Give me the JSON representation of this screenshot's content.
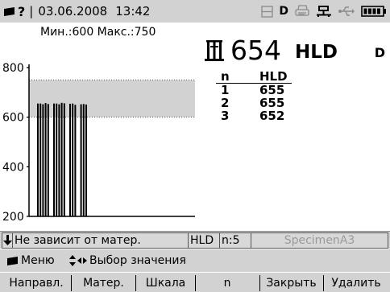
{
  "status_bar": {
    "indicator": "?",
    "separator": "|",
    "date": "03.06.2008",
    "time": "13:42",
    "mode_letter": "D",
    "icons": [
      "memory-card-icon",
      "ready-indicator",
      "printer-icon",
      "network-icon",
      "usb-icon",
      "battery-icon"
    ]
  },
  "chart_data": {
    "type": "bar",
    "ylim": [
      200,
      800
    ],
    "yticks": [
      "800",
      "600",
      "400",
      "200"
    ],
    "ytick_values": [
      800,
      600,
      400,
      200
    ],
    "limit_band": [
      600,
      750
    ],
    "limit_label": "Мин.:600 Макс.:750",
    "values": [
      655,
      655,
      652,
      657,
      653,
      655,
      655,
      652,
      658,
      656,
      654,
      655,
      650,
      652,
      653,
      651
    ],
    "bar_color": "#000000",
    "band_color": "#d2d2d2"
  },
  "reading": {
    "value": "654",
    "unit": "HLD",
    "mode": "D"
  },
  "results_table": {
    "headers": [
      "n",
      "HLD"
    ],
    "rows": [
      [
        "1",
        "655"
      ],
      [
        "2",
        "655"
      ],
      [
        "3",
        "652"
      ]
    ]
  },
  "info_bar": {
    "direction_arrow": "🡇",
    "material": "Не зависит от матер.",
    "scale": "HLD",
    "count": "n:5",
    "specimen": "SpecimenA3"
  },
  "menu_hints": {
    "menu_label": "Меню",
    "select_label": "Выбор значения"
  },
  "softkeys": [
    "Направл.",
    "Матер.",
    "Шкала",
    "n",
    "Закрыть",
    "Удалить"
  ]
}
